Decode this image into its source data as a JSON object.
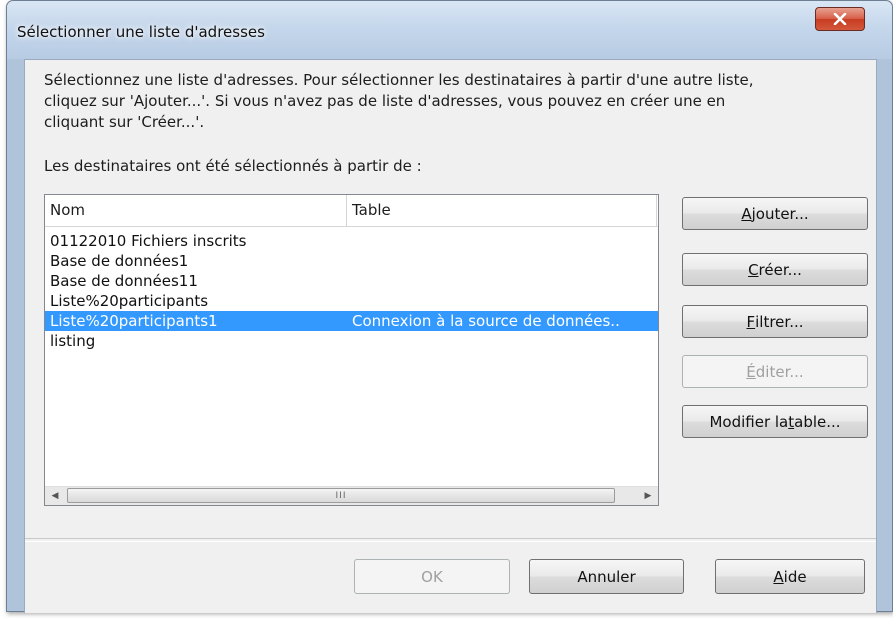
{
  "window": {
    "title": "Sélectionner une liste d'adresses",
    "close_icon": "close-icon"
  },
  "description": "Sélectionnez une liste d'adresses. Pour sélectionner les destinataires à partir d'une autre liste,\ncliquez sur 'Ajouter...'. Si vous n'avez pas de liste d'adresses, vous pouvez en créer une en\ncliquant sur 'Créer...'.",
  "selected_from_label": "Les destinataires ont été sélectionnés à partir de :",
  "list": {
    "columns": [
      "Nom",
      "Table"
    ],
    "rows": [
      {
        "name": "01122010 Fichiers inscrits",
        "table": ""
      },
      {
        "name": "Base de données1",
        "table": ""
      },
      {
        "name": "Base de données11",
        "table": ""
      },
      {
        "name": "Liste%20participants",
        "table": ""
      },
      {
        "name": "Liste%20participants1",
        "table": "Connexion à la source de données..",
        "selected": true
      },
      {
        "name": "listing",
        "table": ""
      }
    ],
    "scrollbar_grip": "III"
  },
  "buttons": {
    "ajouter": {
      "pre": "",
      "key": "A",
      "post": "jouter..."
    },
    "creer": {
      "pre": "",
      "key": "C",
      "post": "réer..."
    },
    "filtrer": {
      "pre": "",
      "key": "F",
      "post": "iltrer..."
    },
    "editer": {
      "pre": "",
      "key": "É",
      "post": "diter..."
    },
    "modifier": {
      "pre": "Modifier la ",
      "key": "t",
      "post": "able..."
    },
    "ok": "OK",
    "annuler": "Annuler",
    "aide": {
      "pre": "",
      "key": "A",
      "post": "ide"
    }
  },
  "colors": {
    "selection": "#3399ff",
    "client_bg": "#f0f0f0",
    "close_button": "#c73c22"
  }
}
